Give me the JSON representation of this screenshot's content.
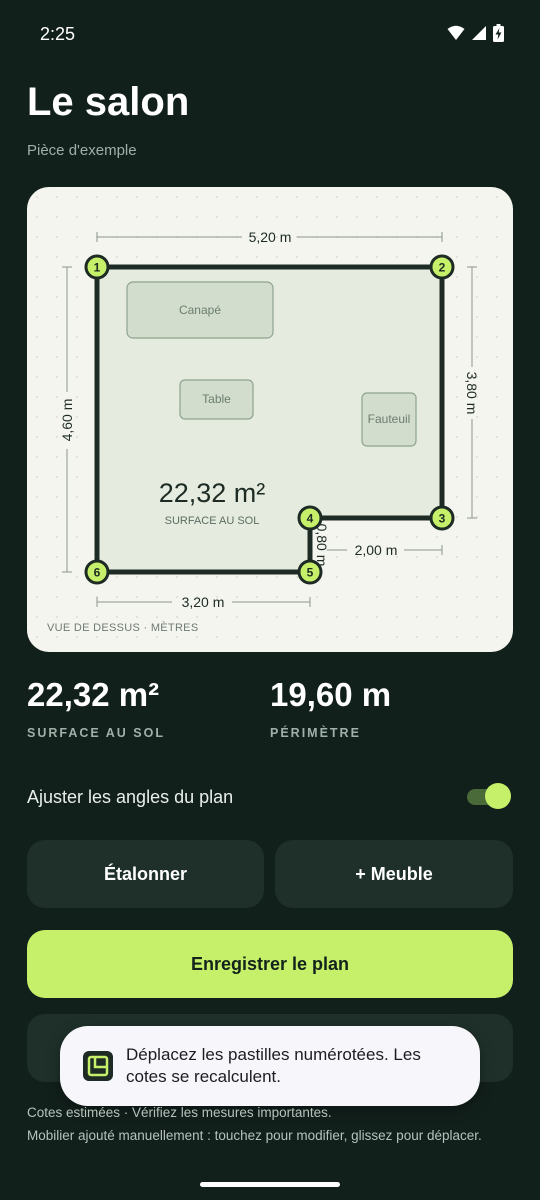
{
  "status_bar": {
    "time": "2:25"
  },
  "header": {
    "title": "Le salon",
    "subtitle": "Pièce d'exemple"
  },
  "plan": {
    "furniture": {
      "sofa": "Canapé",
      "table": "Table",
      "armchair": "Fauteuil"
    },
    "area_label": "22,32 m²",
    "area_caption": "SURFACE AU SOL",
    "dimensions": {
      "top": "5,20 m",
      "left": "4,60 m",
      "right": "3,80 m",
      "bottom": "3,20 m",
      "notch_width": "2,00 m",
      "notch_height": "0,80 m"
    },
    "corners": [
      "1",
      "2",
      "3",
      "4",
      "5",
      "6"
    ],
    "caption": "VUE DE DESSUS · MÈTRES"
  },
  "stats": {
    "area_value": "22,32 m²",
    "area_label": "SURFACE AU SOL",
    "perimeter_value": "19,60 m",
    "perimeter_label": "PÉRIMÈTRE"
  },
  "settings": {
    "snap_label": "Ajuster les angles du plan",
    "snap_enabled": true
  },
  "actions": {
    "calibrate_label": "Étalonner",
    "add_furniture_label": "+ Meuble",
    "save_label": "Enregistrer le plan"
  },
  "toast": {
    "message": "Déplacez les pastilles numérotées. Les cotes se recalculent."
  },
  "footer": {
    "line1": "Cotes estimées · Vérifiez les mesures importantes.",
    "line2": "Mobilier ajouté manuellement : touchez pour modifier, glissez pour déplacer."
  },
  "colors": {
    "background": "#12201c",
    "accent": "#c6f06a",
    "card": "#f5f5ef",
    "button_dark": "#1f302a",
    "wall": "#1d2b24",
    "floor": "#e5ecdf",
    "furniture": "#d3ddcd"
  }
}
